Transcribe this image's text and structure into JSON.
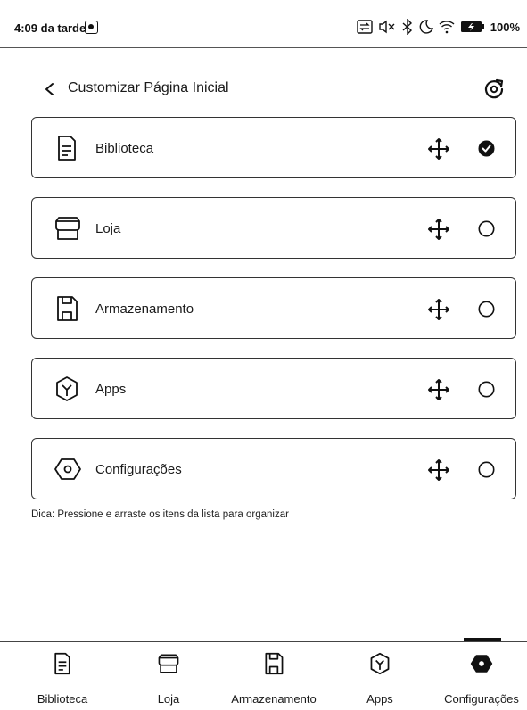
{
  "status_bar": {
    "time": "4:09 da tarde",
    "battery": "100%",
    "icons": [
      "app-indicator-icon",
      "screen-sync-icon",
      "mute-icon",
      "bluetooth-icon",
      "moon-icon",
      "wifi-icon",
      "battery-icon"
    ]
  },
  "header": {
    "back_icon": "chevron-left-icon",
    "title": "Customizar Página Inicial",
    "reset_icon": "reset-icon"
  },
  "items": [
    {
      "label": "Biblioteca",
      "icon": "library-icon",
      "selected": true
    },
    {
      "label": "Loja",
      "icon": "store-icon",
      "selected": false
    },
    {
      "label": "Armazenamento",
      "icon": "storage-icon",
      "selected": false
    },
    {
      "label": "Apps",
      "icon": "apps-icon",
      "selected": false
    },
    {
      "label": "Configurações",
      "icon": "settings-icon",
      "selected": false
    }
  ],
  "hint": "Dica: Pressione e arraste os itens da lista para organizar",
  "bottom_nav": {
    "active": "Configurações",
    "items": [
      {
        "label": "Biblioteca",
        "icon": "library-icon"
      },
      {
        "label": "Loja",
        "icon": "store-icon"
      },
      {
        "label": "Armazenamento",
        "icon": "storage-icon"
      },
      {
        "label": "Apps",
        "icon": "apps-icon"
      },
      {
        "label": "Configurações",
        "icon": "settings-icon"
      }
    ]
  },
  "colors": {
    "ink": "#1a1a1a",
    "border": "#333333",
    "background": "#ffffff"
  }
}
